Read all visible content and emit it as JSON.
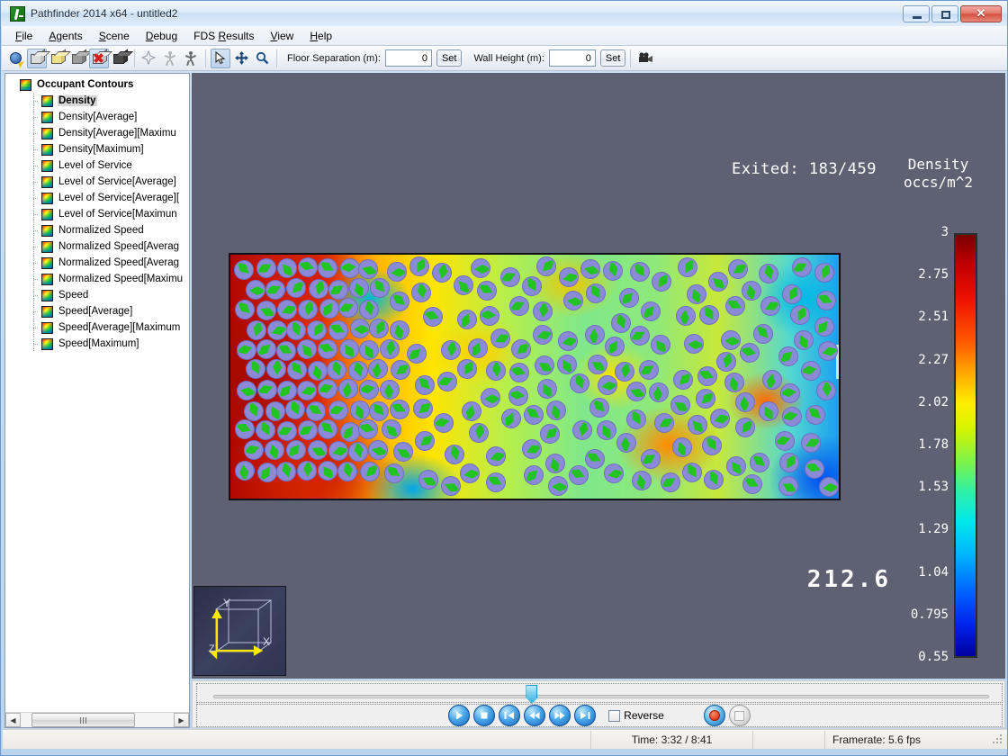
{
  "window": {
    "title": "Pathfinder 2014 x64 - untitled2",
    "app_icon": "runner-icon",
    "minimize_label": "–",
    "maximize_label": "□",
    "close_label": "✕"
  },
  "menu": {
    "items": [
      {
        "label": "File",
        "mnemonic": "F"
      },
      {
        "label": "Agents",
        "mnemonic": "A"
      },
      {
        "label": "Scene",
        "mnemonic": "S"
      },
      {
        "label": "Debug",
        "mnemonic": "D"
      },
      {
        "label": "FDS Results",
        "mnemonic": "R"
      },
      {
        "label": "View",
        "mnemonic": "V"
      },
      {
        "label": "Help",
        "mnemonic": "H"
      }
    ]
  },
  "toolbar": {
    "buttons": [
      {
        "name": "navigate-globe-icon",
        "tip": "Navigate"
      },
      {
        "name": "show-all-floors-icon",
        "tip": "Show all floors"
      },
      {
        "name": "show-current-floor-icon",
        "tip": "Show current floor"
      },
      {
        "name": "show-floor-below-icon",
        "tip": "Show floor below"
      },
      {
        "name": "hide-geometry-icon",
        "tip": "Hide geometry"
      },
      {
        "name": "solid-geometry-icon",
        "tip": "Solid geometry"
      },
      {
        "name": "show-paths-icon",
        "tip": "Show paths"
      },
      {
        "name": "show-occupants-icon",
        "tip": "Show occupants"
      },
      {
        "name": "show-occupant-trails-icon",
        "tip": "Occupant trails"
      },
      {
        "name": "select-tool-icon",
        "tip": "Select",
        "pressed": true
      },
      {
        "name": "pan-tool-icon",
        "tip": "Pan"
      },
      {
        "name": "zoom-tool-icon",
        "tip": "Zoom"
      }
    ],
    "floor_separation_label": "Floor Separation (m):",
    "floor_separation_value": "0",
    "floor_separation_set": "Set",
    "wall_height_label": "Wall Height (m):",
    "wall_height_value": "0",
    "wall_height_set": "Set",
    "movie_icon": "movie-camera-icon"
  },
  "sidebar": {
    "root": {
      "label": "Occupant Contours",
      "expanded": true
    },
    "items": [
      {
        "label": "Density",
        "selected": true
      },
      {
        "label": "Density[Average]",
        "selected": false
      },
      {
        "label": "Density[Average][Maximu",
        "selected": false
      },
      {
        "label": "Density[Maximum]",
        "selected": false
      },
      {
        "label": "Level of Service",
        "selected": false
      },
      {
        "label": "Level of Service[Average]",
        "selected": false
      },
      {
        "label": "Level of Service[Average][",
        "selected": false
      },
      {
        "label": "Level of Service[Maximun",
        "selected": false
      },
      {
        "label": "Normalized Speed",
        "selected": false
      },
      {
        "label": "Normalized Speed[Averag",
        "selected": false
      },
      {
        "label": "Normalized Speed[Averag",
        "selected": false
      },
      {
        "label": "Normalized Speed[Maximu",
        "selected": false
      },
      {
        "label": "Speed",
        "selected": false
      },
      {
        "label": "Speed[Average]",
        "selected": false
      },
      {
        "label": "Speed[Average][Maximum",
        "selected": false
      },
      {
        "label": "Speed[Maximum]",
        "selected": false
      }
    ],
    "scroll_left_icon": "triangle-left-icon",
    "scroll_right_icon": "triangle-right-icon"
  },
  "viewport": {
    "exited_text": "Exited: 183/459",
    "time_display": "212.6",
    "axis_widget": {
      "x_label": "X",
      "y_label": "Y",
      "z_label": "Z"
    },
    "background_color": "#5d6172"
  },
  "chart_data": {
    "type": "heatmap",
    "title": "Density",
    "subtitle": "occs/m^2",
    "unit": "occs/m^2",
    "colormap": "jet",
    "legend_position": "right",
    "tick_labels": [
      "3",
      "2.75",
      "2.51",
      "2.27",
      "2.02",
      "1.78",
      "1.53",
      "1.29",
      "1.04",
      "0.795",
      "0.55"
    ],
    "tick_values": [
      3,
      2.75,
      2.51,
      2.27,
      2.02,
      1.78,
      1.53,
      1.29,
      1.04,
      0.795,
      0.55
    ],
    "zlim": [
      0.55,
      3
    ],
    "colorbar_stops": [
      "#7a0000",
      "#ef1000",
      "#ffaa00",
      "#ffee00",
      "#7cf24a",
      "#00e8ea",
      "#00b4ff",
      "#0020e8",
      "#00009e"
    ],
    "occupant_marker_color": "#8a8ad8",
    "occupant_arrow_color": "#22c422",
    "occupants_visible": 276,
    "exited": 183,
    "total": 459
  },
  "timeline": {
    "slider_position_percent": 41,
    "transport": [
      {
        "name": "play-button",
        "glyph": "play"
      },
      {
        "name": "pause-button",
        "glyph": "pause"
      },
      {
        "name": "skip-to-start-button",
        "glyph": "skip-back"
      },
      {
        "name": "rewind-button",
        "glyph": "rewind"
      },
      {
        "name": "fast-forward-button",
        "glyph": "fast-forward"
      },
      {
        "name": "skip-to-end-button",
        "glyph": "skip-forward"
      }
    ],
    "reverse_label": "Reverse",
    "reverse_checked": false,
    "record_button": "record-button",
    "stop_record_button": "stop-record-button"
  },
  "statusbar": {
    "time": "Time: 3:32 / 8:41",
    "framerate": "Framerate: 5.6 fps"
  }
}
